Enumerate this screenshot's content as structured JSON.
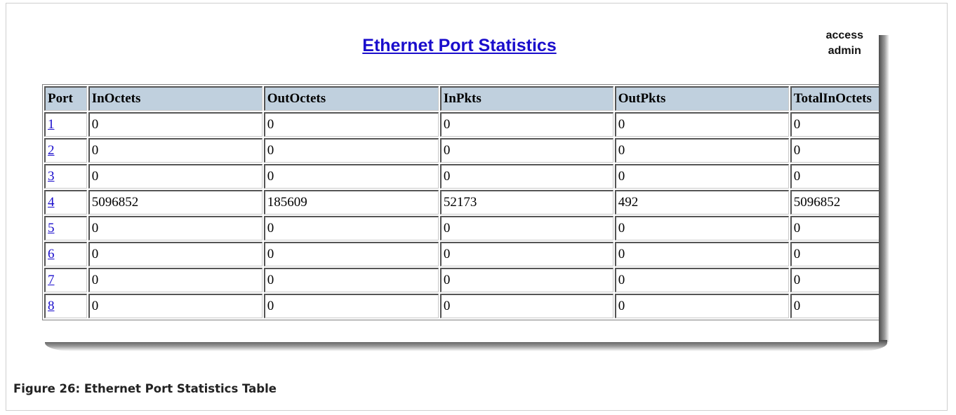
{
  "page": {
    "title": "Ethernet Port Statistics",
    "access_label": "access",
    "user": "admin"
  },
  "table": {
    "headers": [
      "Port",
      "InOctets",
      "OutOctets",
      "InPkts",
      "OutPkts",
      "TotalInOctets"
    ],
    "rows": [
      [
        "1",
        "0",
        "0",
        "0",
        "0",
        "0"
      ],
      [
        "2",
        "0",
        "0",
        "0",
        "0",
        "0"
      ],
      [
        "3",
        "0",
        "0",
        "0",
        "0",
        "0"
      ],
      [
        "4",
        "5096852",
        "185609",
        "52173",
        "492",
        "5096852"
      ],
      [
        "5",
        "0",
        "0",
        "0",
        "0",
        "0"
      ],
      [
        "6",
        "0",
        "0",
        "0",
        "0",
        "0"
      ],
      [
        "7",
        "0",
        "0",
        "0",
        "0",
        "0"
      ],
      [
        "8",
        "0",
        "0",
        "0",
        "0",
        "0"
      ]
    ]
  },
  "caption": "Figure 26: Ethernet Port Statistics Table",
  "colors": {
    "link": "#1a0dcc",
    "header_bg": "#c0d0de"
  }
}
